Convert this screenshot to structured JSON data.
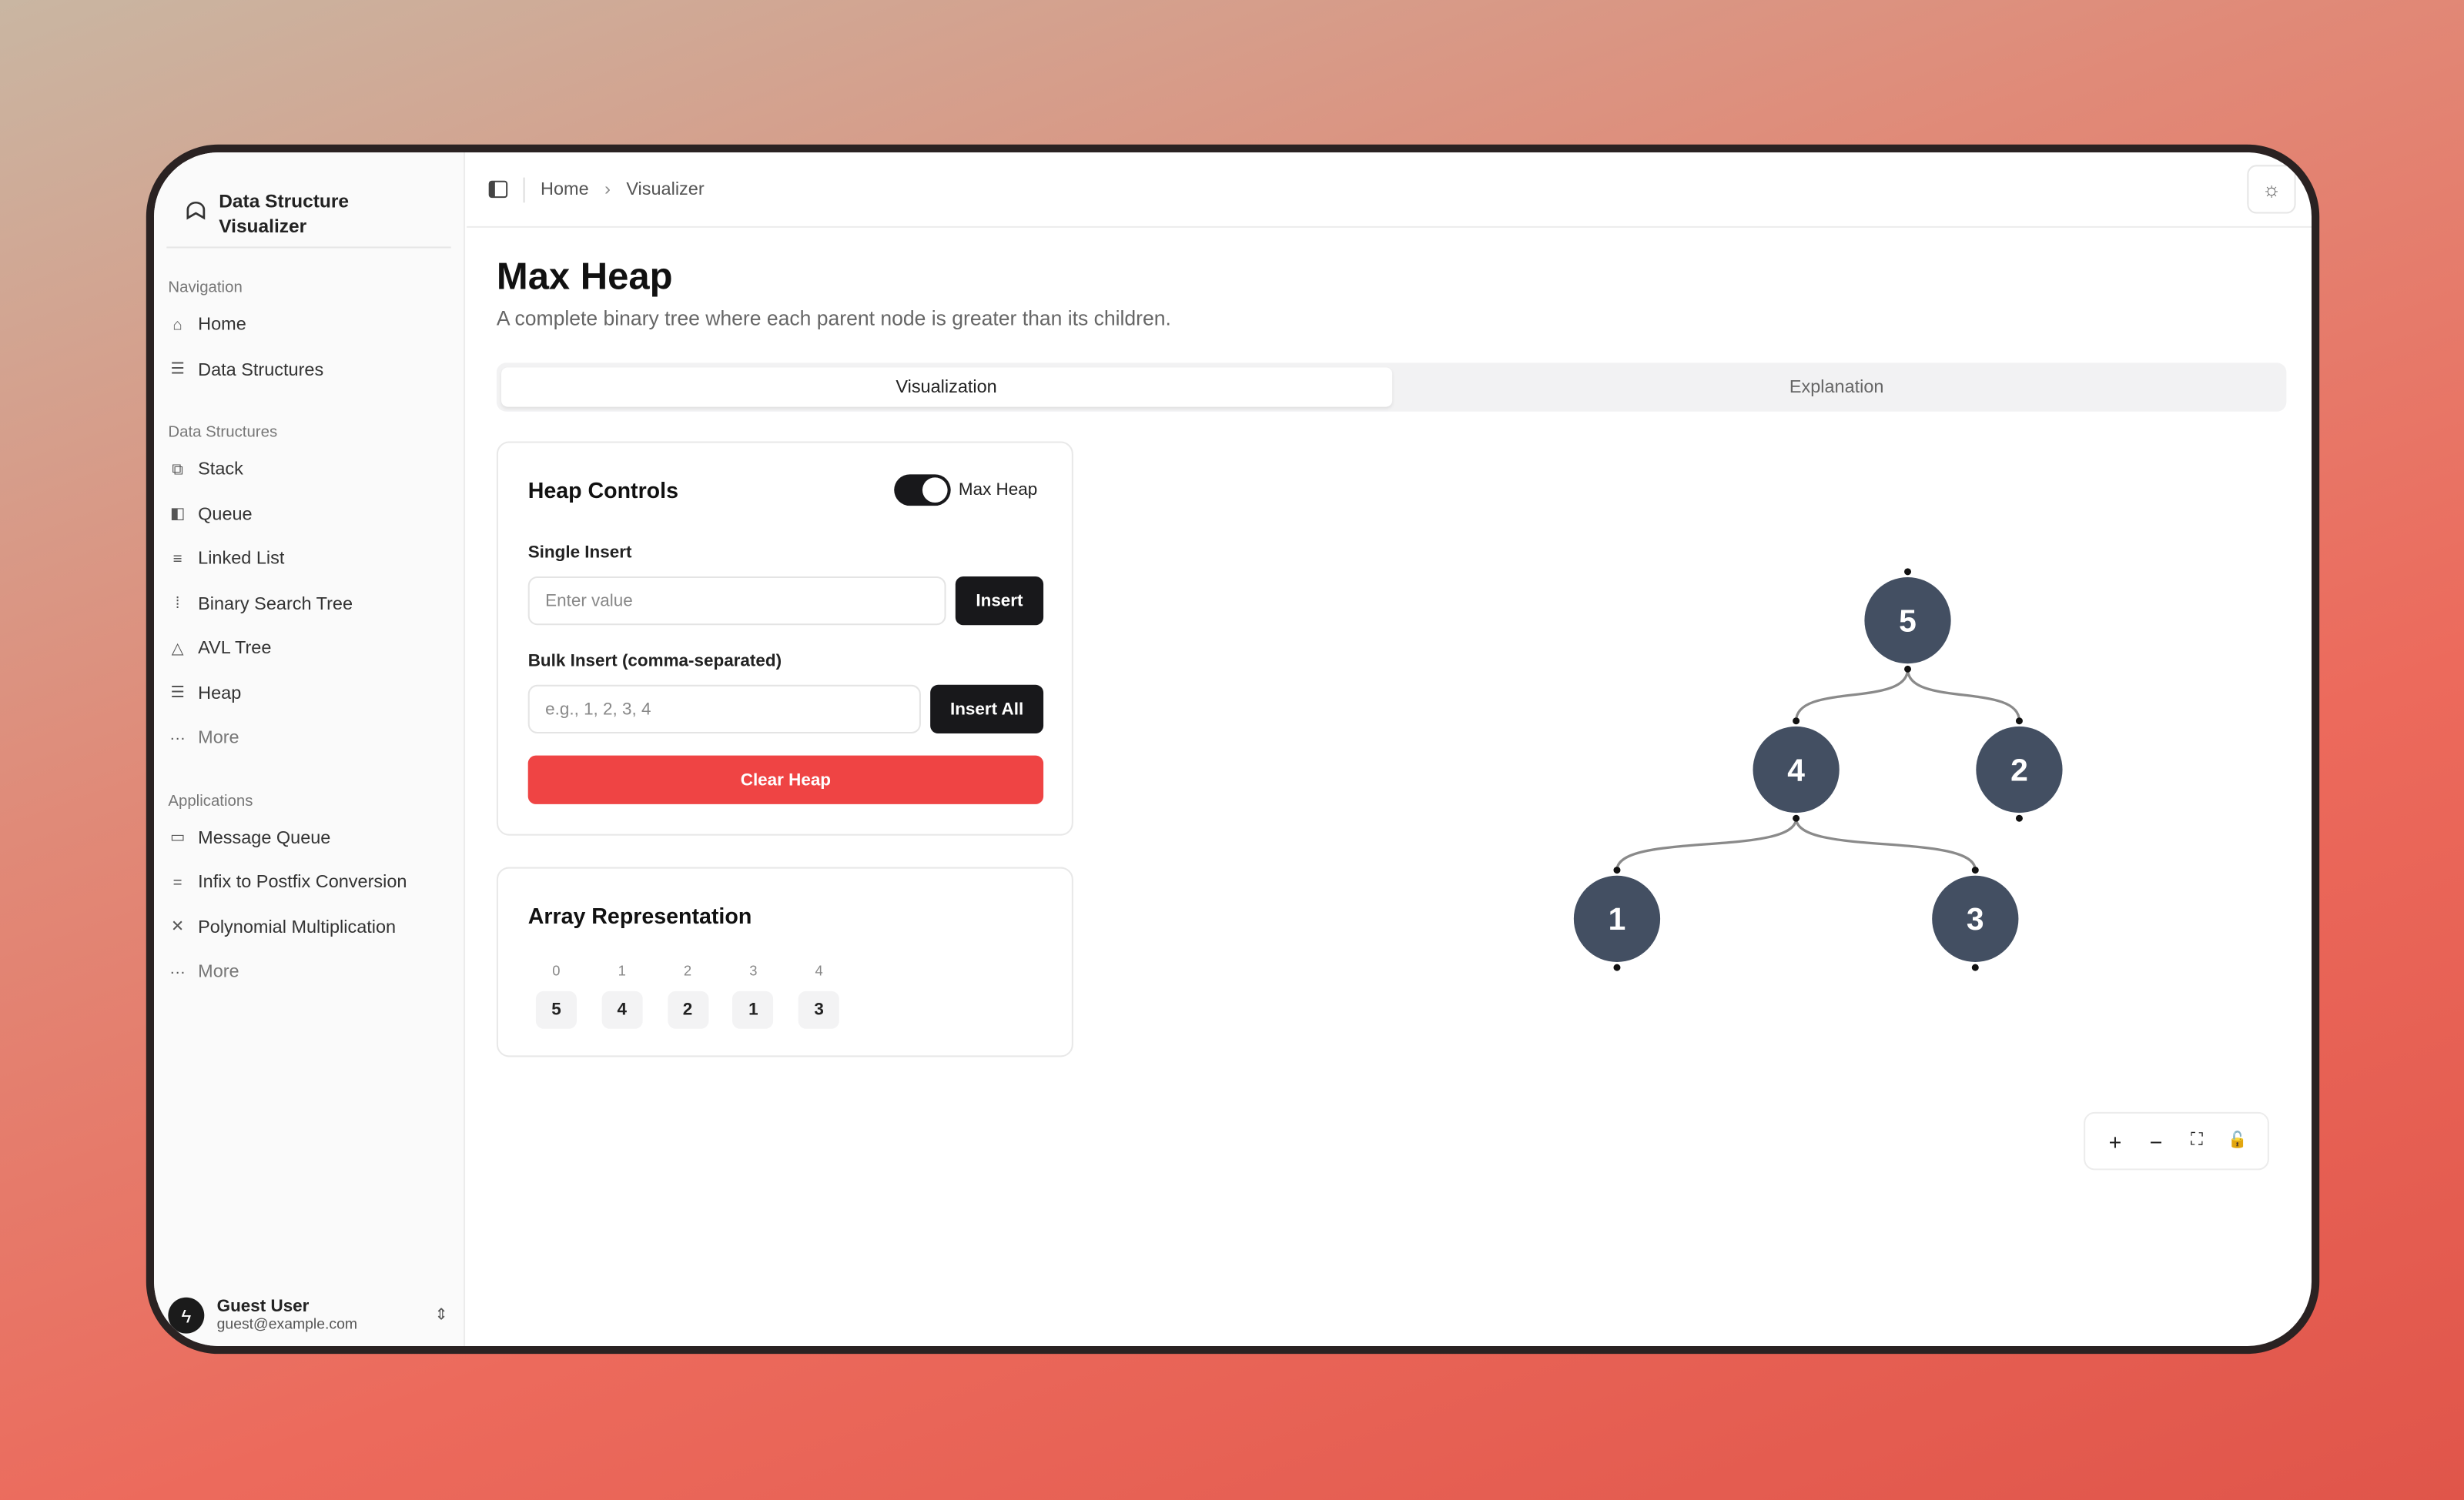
{
  "app": {
    "title_line1": "Data Structure",
    "title_line2": "Visualizer"
  },
  "sidebar": {
    "groups": [
      {
        "label": "Navigation",
        "items": [
          {
            "label": "Home",
            "icon": "home-icon"
          },
          {
            "label": "Data Structures",
            "icon": "database-icon"
          }
        ]
      },
      {
        "label": "Data Structures",
        "items": [
          {
            "label": "Stack",
            "icon": "stack-icon"
          },
          {
            "label": "Queue",
            "icon": "queue-icon"
          },
          {
            "label": "Linked List",
            "icon": "list-icon"
          },
          {
            "label": "Binary Search Tree",
            "icon": "tree-icon"
          },
          {
            "label": "AVL Tree",
            "icon": "triangle-icon"
          },
          {
            "label": "Heap",
            "icon": "database-icon"
          },
          {
            "label": "More",
            "icon": "more-icon"
          }
        ]
      },
      {
        "label": "Applications",
        "items": [
          {
            "label": "Message Queue",
            "icon": "message-icon"
          },
          {
            "label": "Infix to Postfix Conversion",
            "icon": "equals-icon"
          },
          {
            "label": "Polynomial Multiplication",
            "icon": "x-icon"
          },
          {
            "label": "More",
            "icon": "more-icon"
          }
        ]
      }
    ],
    "user": {
      "name": "Guest User",
      "email": "guest@example.com"
    }
  },
  "breadcrumb": {
    "home": "Home",
    "current": "Visualizer"
  },
  "page": {
    "title": "Max Heap",
    "subtitle": "A complete binary tree where each parent node is greater than its children."
  },
  "tabs": [
    {
      "label": "Visualization",
      "active": true
    },
    {
      "label": "Explanation",
      "active": false
    }
  ],
  "controls": {
    "title": "Heap Controls",
    "toggle_label": "Max Heap",
    "toggle_on": true,
    "single_label": "Single Insert",
    "single_placeholder": "Enter value",
    "insert": "Insert",
    "bulk_label": "Bulk Insert (comma-separated)",
    "bulk_placeholder": "e.g., 1, 2, 3, 4",
    "insert_all": "Insert All",
    "clear": "Clear Heap",
    "clear_color": "#ef4444"
  },
  "array": {
    "title": "Array Representation",
    "indices": [
      "0",
      "1",
      "2",
      "3",
      "4"
    ],
    "values": [
      "5",
      "4",
      "2",
      "1",
      "3"
    ]
  },
  "tree": {
    "node_color": "#434f62",
    "nodes": [
      "5",
      "4",
      "2",
      "1",
      "3"
    ]
  }
}
